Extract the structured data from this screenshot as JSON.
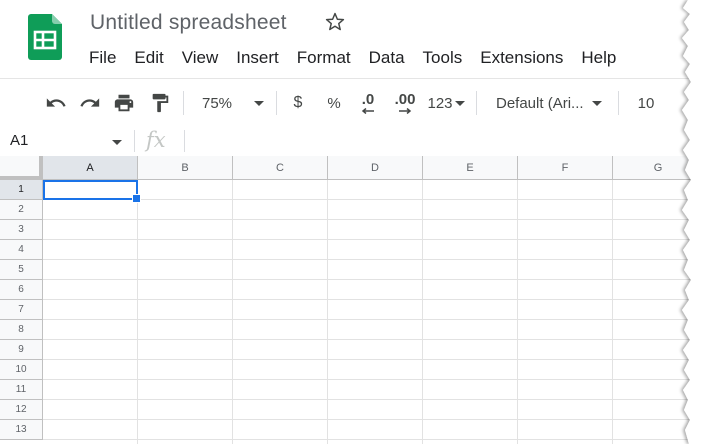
{
  "app": {
    "title": "Untitled spreadsheet",
    "logo_icon": "google-sheets-logo-icon",
    "star_icon": "star-outline-icon"
  },
  "menu": [
    "File",
    "Edit",
    "View",
    "Insert",
    "Format",
    "Data",
    "Tools",
    "Extensions",
    "Help"
  ],
  "toolbar": {
    "undo_icon": "undo-icon",
    "redo_icon": "redo-icon",
    "print_icon": "print-icon",
    "paint_format_icon": "paint-format-icon",
    "zoom": "75%",
    "currency": "$",
    "percent": "%",
    "decrease_decimal": ".0",
    "increase_decimal": ".00",
    "more_formats": "123",
    "font": "Default (Ari...",
    "font_size": "10"
  },
  "formula_bar": {
    "name_box": "A1",
    "fx_label": "fx",
    "value": ""
  },
  "grid": {
    "columns": [
      "A",
      "B",
      "C",
      "D",
      "E",
      "F",
      "G"
    ],
    "rows": [
      "1",
      "2",
      "3",
      "4",
      "5",
      "6",
      "7",
      "8",
      "9",
      "10",
      "11",
      "12",
      "13"
    ],
    "selected_cell": "A1"
  },
  "colors": {
    "accent": "#1a73e8",
    "sheets_green": "#0f9d58",
    "header_bg": "#f8f9fa",
    "selected_header_bg": "#e1e5ea"
  }
}
